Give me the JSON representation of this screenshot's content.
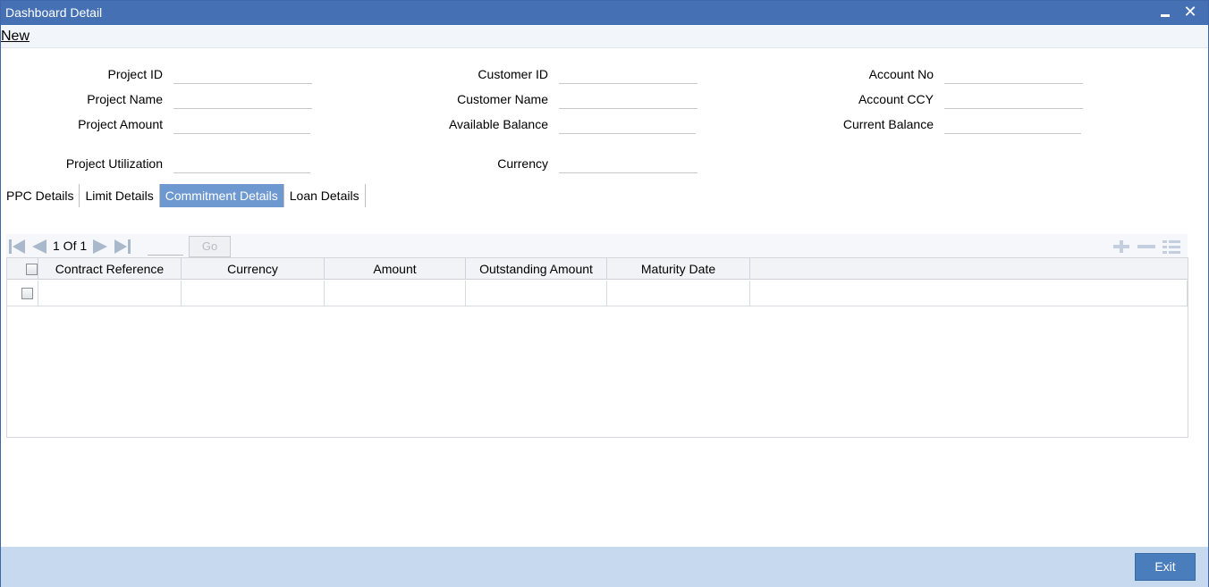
{
  "window": {
    "title": "Dashboard Detail"
  },
  "menu": {
    "new_label": "New"
  },
  "form": {
    "project_id_label": "Project ID",
    "project_name_label": "Project Name",
    "project_amount_label": "Project Amount",
    "project_utilization_label": "Project Utilization",
    "customer_id_label": "Customer ID",
    "customer_name_label": "Customer Name",
    "available_balance_label": "Available Balance",
    "currency_label": "Currency",
    "account_no_label": "Account No",
    "account_ccy_label": "Account CCY",
    "current_balance_label": "Current Balance",
    "values": {
      "project_id": "",
      "project_name": "",
      "project_amount": "",
      "project_utilization": "",
      "customer_id": "",
      "customer_name": "",
      "available_balance": "",
      "currency": "",
      "account_no": "",
      "account_ccy": "",
      "current_balance": ""
    }
  },
  "tabs": [
    {
      "label": "PPC Details",
      "active": false
    },
    {
      "label": "Limit Details",
      "active": false
    },
    {
      "label": "Commitment Details",
      "active": true
    },
    {
      "label": "Loan Details",
      "active": false
    }
  ],
  "grid": {
    "pager_text": "1 Of 1",
    "go_label": "Go",
    "columns": [
      "Contract Reference",
      "Currency",
      "Amount",
      "Outstanding Amount",
      "Maturity Date"
    ],
    "rows": [
      {
        "contract_reference": "",
        "currency": "",
        "amount": "",
        "outstanding_amount": "",
        "maturity_date": ""
      }
    ]
  },
  "icons": {
    "first": "first-page-icon",
    "prev": "previous-page-icon",
    "next": "next-page-icon",
    "last": "last-page-icon",
    "add": "add-row-icon",
    "delete": "delete-row-icon",
    "view": "single-view-icon",
    "minimize": "minimize-icon",
    "close": "close-icon"
  },
  "footer": {
    "exit_label": "Exit"
  },
  "colors": {
    "titlebar": "#4571b4",
    "active_tab": "#6e98d0",
    "footer": "#c6d9ee",
    "exit_button": "#4a7dbb"
  }
}
